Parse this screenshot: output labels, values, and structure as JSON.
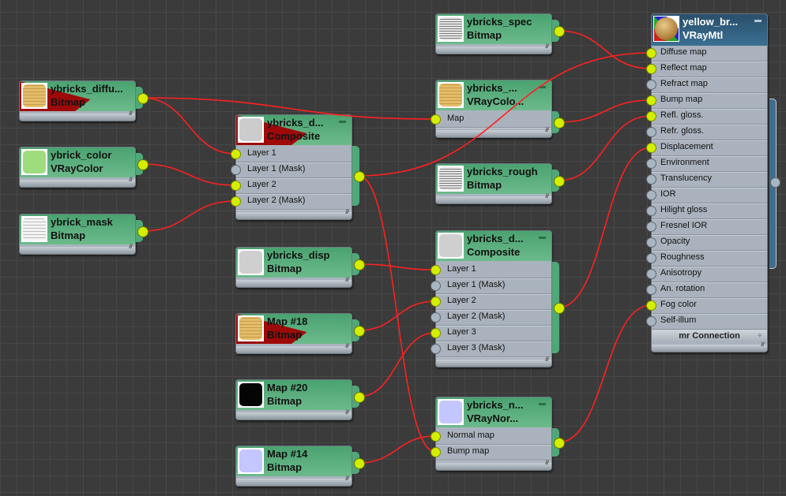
{
  "app": {
    "view": "Slate Material Editor - node view"
  },
  "colors": {
    "wire": "#ff2020",
    "socket_connected": "#d4ee00",
    "socket_empty": "#a8b5c3",
    "map_header": "#4aa270",
    "material_header": "#294f6b",
    "warning": "#9e0a0a",
    "background": "#3b3b3b"
  },
  "nodes": {
    "diffuse": {
      "name": "ybricks_diffu...",
      "type": "Bitmap",
      "thumb": "yellow-brick-texture",
      "warning": true
    },
    "color": {
      "name": "ybrick_color",
      "type": "VRayColor",
      "thumb": "light-green-swatch"
    },
    "mask": {
      "name": "ybrick_mask",
      "type": "Bitmap",
      "thumb": "white-brick-mask"
    },
    "comp1": {
      "name": "ybricks_d...",
      "type": "Composite",
      "warning": true,
      "slots": [
        "Layer 1",
        "Layer 1 (Mask)",
        "Layer 2",
        "Layer 2 (Mask)"
      ],
      "connected": [
        true,
        false,
        true,
        true
      ]
    },
    "disp": {
      "name": "ybricks_disp",
      "type": "Bitmap",
      "thumb": "grey-displacement"
    },
    "map18": {
      "name": "Map #18",
      "type": "Bitmap",
      "warning": true,
      "thumb": "yellow-brick-texture"
    },
    "map20": {
      "name": "Map #20",
      "type": "Bitmap",
      "thumb": "black-texture"
    },
    "map14": {
      "name": "Map #14",
      "type": "Bitmap",
      "thumb": "normal-lavender"
    },
    "spec": {
      "name": "ybricks_spec",
      "type": "Bitmap",
      "thumb": "grey-brick"
    },
    "vcc": {
      "name": "ybricks_...",
      "type": "VRayColo...",
      "slots": [
        "Map"
      ],
      "connected": [
        true
      ]
    },
    "rough": {
      "name": "ybricks_rough",
      "type": "Bitmap",
      "thumb": "grey-brick"
    },
    "comp2": {
      "name": "ybricks_d...",
      "type": "Composite",
      "slots": [
        "Layer 1",
        "Layer 1 (Mask)",
        "Layer 2",
        "Layer 2 (Mask)",
        "Layer 3",
        "Layer 3 (Mask)"
      ],
      "connected": [
        true,
        false,
        true,
        false,
        true,
        false
      ]
    },
    "vnorm": {
      "name": "ybricks_n...",
      "type": "VRayNor...",
      "slots": [
        "Normal map",
        "Bump map"
      ],
      "connected": [
        true,
        true
      ]
    },
    "mtl": {
      "name": "yellow_br...",
      "type": "VRayMtl",
      "slots": [
        "Diffuse map",
        "Reflect map",
        "Refract map",
        "Bump map",
        "Refl. gloss.",
        "Refr. gloss.",
        "Displacement",
        "Environment",
        "Translucency",
        "IOR",
        "Hilight gloss",
        "Fresnel IOR",
        "Opacity",
        "Roughness",
        "Anisotropy",
        "An. rotation",
        "Fog color",
        "Self-illum"
      ],
      "connected": [
        true,
        true,
        false,
        true,
        true,
        false,
        true,
        false,
        false,
        false,
        false,
        false,
        false,
        false,
        false,
        false,
        true,
        false
      ],
      "footer": "mr Connection",
      "footer_btn": "+"
    }
  },
  "connections": [
    {
      "from": "diffuse",
      "to": "comp1.Layer 1"
    },
    {
      "from": "diffuse",
      "to": "vcc.Map"
    },
    {
      "from": "color",
      "to": "comp1.Layer 2"
    },
    {
      "from": "mask",
      "to": "comp1.Layer 2 (Mask)"
    },
    {
      "from": "comp1",
      "to": "mtl.Diffuse map"
    },
    {
      "from": "comp1",
      "to": "vnorm.Bump map"
    },
    {
      "from": "spec",
      "to": "mtl.Reflect map"
    },
    {
      "from": "vcc",
      "to": "mtl.Bump map"
    },
    {
      "from": "rough",
      "to": "mtl.Refl. gloss."
    },
    {
      "from": "disp",
      "to": "comp2.Layer 1"
    },
    {
      "from": "map18",
      "to": "comp2.Layer 2"
    },
    {
      "from": "map20",
      "to": "comp2.Layer 3"
    },
    {
      "from": "map14",
      "to": "vnorm.Normal map"
    },
    {
      "from": "comp2",
      "to": "mtl.Displacement"
    },
    {
      "from": "vnorm",
      "to": "mtl.Fog color"
    }
  ]
}
